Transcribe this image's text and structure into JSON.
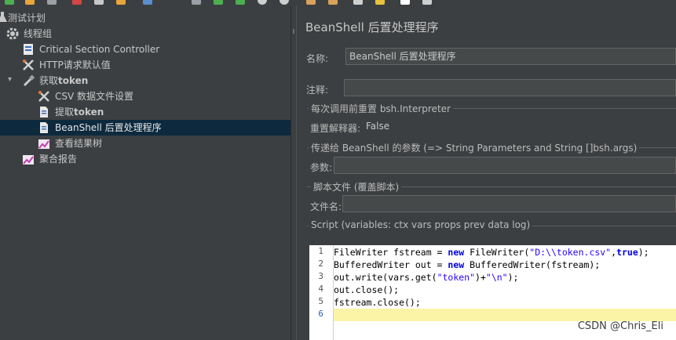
{
  "tree": {
    "items": [
      {
        "label": "测试计划"
      },
      {
        "label": "线程组"
      },
      {
        "label": "Critical Section Controller"
      },
      {
        "label": "HTTP请求默认值"
      },
      {
        "label_prefix": "获取",
        "label_bold": "token"
      },
      {
        "label": "CSV 数据文件设置"
      },
      {
        "label_prefix": "提取",
        "label_bold": "token"
      },
      {
        "label": "BeanShell 后置处理程序"
      },
      {
        "label": "查看结果树"
      },
      {
        "label": "聚合报告"
      }
    ]
  },
  "panel": {
    "title": "BeanShell 后置处理程序",
    "name_label": "名称:",
    "name_value": "BeanShell 后置处理程序",
    "comment_label": "注释:",
    "comment_value": "",
    "reset_group_title": "每次调用前重置 bsh.Interpreter",
    "reset_label": "重置解释器:",
    "reset_value": "False",
    "params_group_title": "传递给 BeanShell 的参数 (=> String Parameters and String []bsh.args)",
    "params_label": "参数:",
    "params_value": "",
    "file_group_title": "脚本文件 (覆盖脚本)",
    "file_label": "文件名:",
    "file_value": "",
    "script_title": "Script (variables: ctx vars props prev data log)"
  },
  "script": {
    "line_numbers": [
      "1",
      "2",
      "3",
      "4",
      "5",
      "6"
    ],
    "lines": [
      "FileWriter fstream = new FileWriter(\"D:\\\\token.csv\",true);",
      "BufferedWriter out = new BufferedWriter(fstream);",
      "out.write(vars.get(\"token\")+\"\\n\");",
      "out.close();",
      "fstream.close();",
      ""
    ],
    "current_line": 6
  },
  "watermark": "CSDN @Chris_Eli",
  "colors": {
    "background": "#3c3f41",
    "selected_row": "#0d293e",
    "current_line": "#fbf4a6",
    "keyword": "#0000e6",
    "string": "#2a00ff"
  },
  "icons": [
    "gear-icon",
    "controller-icon",
    "wrench-icon",
    "dropper-icon",
    "document-icon",
    "graph-icon",
    "arrow-down-icon"
  ]
}
